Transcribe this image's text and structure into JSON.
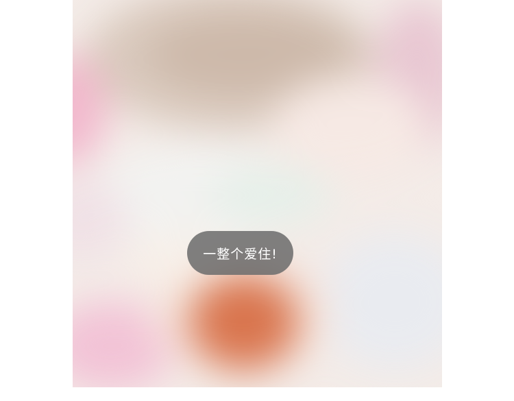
{
  "toast": {
    "message": "一整个爱住!"
  },
  "background": {
    "description_icon": "blurred-photo",
    "colors": {
      "base": "#f4ece8",
      "accent_orange": "#d9754e",
      "accent_pink": "#f2b8cd",
      "toast_bg": "#6e6e6e"
    }
  }
}
